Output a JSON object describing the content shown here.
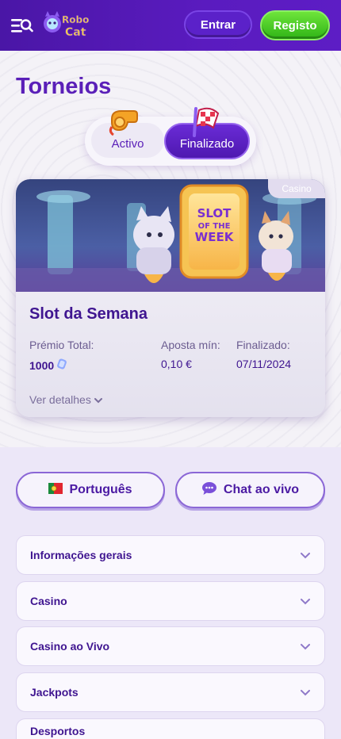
{
  "header": {
    "logo_text_top": "Robo",
    "logo_text_bottom": "Cat",
    "login_label": "Entrar",
    "register_label": "Registo"
  },
  "page": {
    "title": "Torneios"
  },
  "tabs": {
    "active_label": "Activo",
    "finished_label": "Finalizado",
    "selected": "Finalizado"
  },
  "tournament": {
    "badge": "Casino",
    "banner_text_line1": "SLOT",
    "banner_text_line2": "OF THE",
    "banner_text_line3": "WEEK",
    "title": "Slot da Semana",
    "prize_label": "Prémio Total:",
    "prize_value": "1000",
    "min_bet_label": "Aposta mín:",
    "min_bet_value": "0,10 €",
    "finished_label": "Finalizado:",
    "finished_value": "07/11/2024",
    "details_label": "Ver detalhes"
  },
  "footer": {
    "language_label": "Português",
    "chat_label": "Chat ao vivo",
    "accordion": [
      "Informações gerais",
      "Casino",
      "Casino ao Vivo",
      "Jackpots",
      "Desportos"
    ]
  },
  "colors": {
    "brand_purple": "#5a1fb8",
    "register_green": "#3fc21e",
    "header_bg": "#4a16a6"
  }
}
